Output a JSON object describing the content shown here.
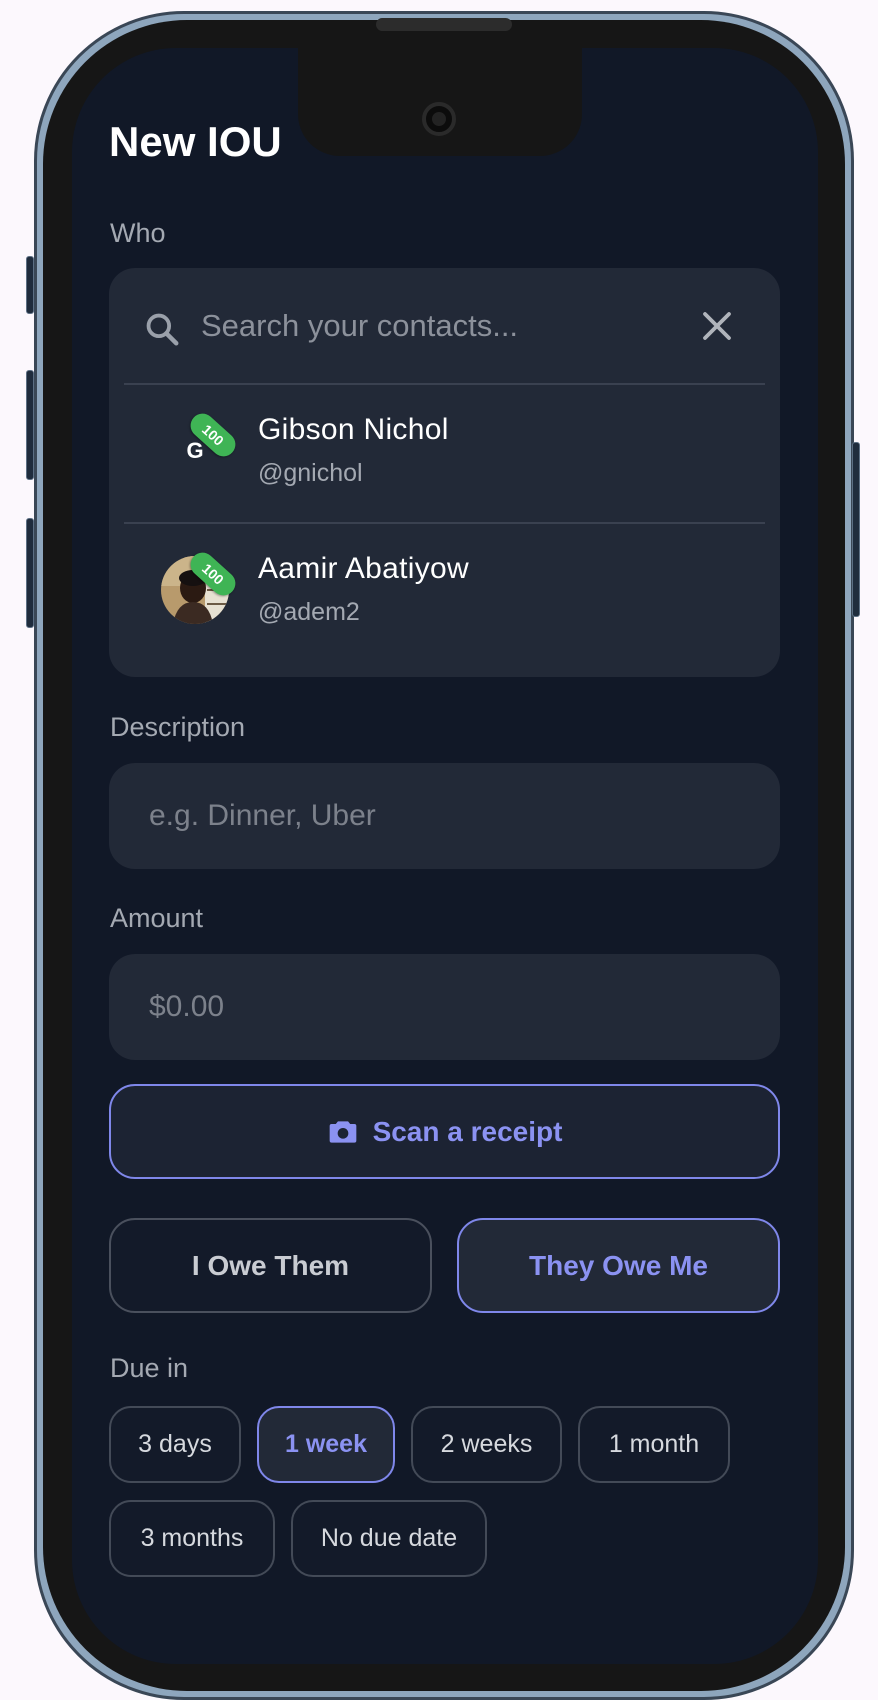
{
  "page": {
    "title": "New IOU"
  },
  "who": {
    "label": "Who",
    "search_placeholder": "Search your contacts...",
    "search_icon": "search-icon",
    "clear_icon": "close-icon",
    "contacts": [
      {
        "name": "Gibson Nichol",
        "handle": "@gnichol",
        "initial": "G",
        "score": "100",
        "avatar": "letter"
      },
      {
        "name": "Aamir Abatiyow",
        "handle": "@adem2",
        "initial": "",
        "score": "100",
        "avatar": "photo"
      }
    ]
  },
  "description": {
    "label": "Description",
    "placeholder": "e.g. Dinner, Uber",
    "value": ""
  },
  "amount": {
    "label": "Amount",
    "placeholder": "$0.00",
    "value": ""
  },
  "scan": {
    "label": "Scan a receipt",
    "icon": "camera-icon"
  },
  "direction": {
    "options": [
      "I Owe Them",
      "They Owe Me"
    ],
    "selected": "They Owe Me"
  },
  "due": {
    "label": "Due in",
    "options": [
      "3 days",
      "1 week",
      "2 weeks",
      "1 month",
      "3 months",
      "No due date"
    ],
    "selected": "1 week"
  },
  "colors": {
    "background": "#111827",
    "surface": "#222937",
    "accent": "#7f87ea",
    "badge": "#3fb455",
    "muted_text": "#a4a9b2"
  }
}
